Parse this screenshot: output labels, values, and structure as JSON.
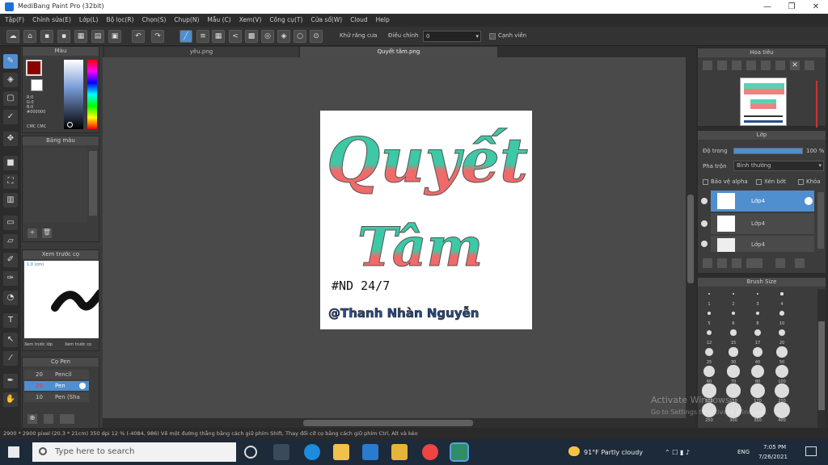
{
  "window": {
    "title": "MediBang Paint Pro (32bit)",
    "minimize": "—",
    "maximize": "❐",
    "close": "✕"
  },
  "menu": [
    "Tập(F)",
    "Chỉnh sửa(E)",
    "Lớp(L)",
    "Bộ lọc(R)",
    "Chọn(S)",
    "Chụp(N)",
    "Mẫu (C)",
    "Xem(V)",
    "Công cụ(T)",
    "Cửa sổ(W)",
    "Cloud",
    "Help"
  ],
  "toolbar": {
    "anti_alias_label": "Khử răng cưa",
    "correction_label": "Điều chỉnh",
    "correction_value": "0",
    "edge_label": "Cạnh viền"
  },
  "tabs": [
    {
      "label": "yêu.png"
    },
    {
      "label": "Quyết tâm.png"
    }
  ],
  "color_panel": {
    "title": "Màu",
    "hex_readout": "R:0\nG:0\nB:0\n#000000",
    "bottom_readout": "CMC CMC"
  },
  "palette_panel": {
    "title": "Bảng màu"
  },
  "brush_preview_panel": {
    "title": "Xem trước cọ",
    "label_tl": "1.0 (cm)",
    "bottom_a": "Xem trước lớp",
    "bottom_b": "Xem trước cọ"
  },
  "brush_list_panel": {
    "title": "Cọ Pen",
    "items": [
      {
        "size": "20",
        "name": "Pencil"
      },
      {
        "size": "20",
        "name": "Pen"
      },
      {
        "size": "10",
        "name": "Pen (Sha"
      }
    ]
  },
  "artwork": {
    "line1": "Quyết",
    "line2": "Tâm",
    "line3": "#ND 24/7",
    "line4": "@Thanh Nhàn Nguyễn"
  },
  "navigator_panel": {
    "title": "Hoa tiêu"
  },
  "layer_panel": {
    "title": "Lớp",
    "opacity_label": "Độ trong",
    "opacity_value": "100 %",
    "blend_label": "Pha trộn",
    "blend_value": "Bình thường",
    "protect_alpha": "Bảo vệ alpha",
    "clipping": "Xén bớt",
    "lock": "Khóa",
    "layers": [
      {
        "name": "Lớp4"
      },
      {
        "name": "Lớp4"
      },
      {
        "name": "Lớp4"
      }
    ]
  },
  "brush_size_panel": {
    "title": "Brush Size",
    "sizes": [
      "1",
      "2",
      "3",
      "4",
      "5",
      "6",
      "8",
      "10",
      "12",
      "15",
      "17",
      "20",
      "25",
      "30",
      "40",
      "50",
      "60",
      "70",
      "80",
      "100",
      "120",
      "150",
      "170",
      "200",
      "250",
      "300",
      "350",
      "400"
    ]
  },
  "status": {
    "text": "2900 * 2900 pixel (20.3 * 21cm) 350 dpi 12 % (-4084, 986) Vẽ một đường thẳng bằng cách giữ phím Shift, Thay đổi cỡ cọ bằng cách giữ phím Ctrl, Alt và kéo"
  },
  "activation": {
    "line1": "Activate Windows",
    "line2": "Go to Settings to activate Windows."
  },
  "taskbar": {
    "search_placeholder": "Type here to search",
    "weather": "91°F Partly cloudy",
    "lang": "ENG",
    "time": "7:05 PM",
    "date": "7/26/2021"
  },
  "colors": {
    "accent": "#4f8ecf",
    "teal": "#3ec8a5",
    "coral": "#f06a6a",
    "panel": "#3c3c3c"
  }
}
